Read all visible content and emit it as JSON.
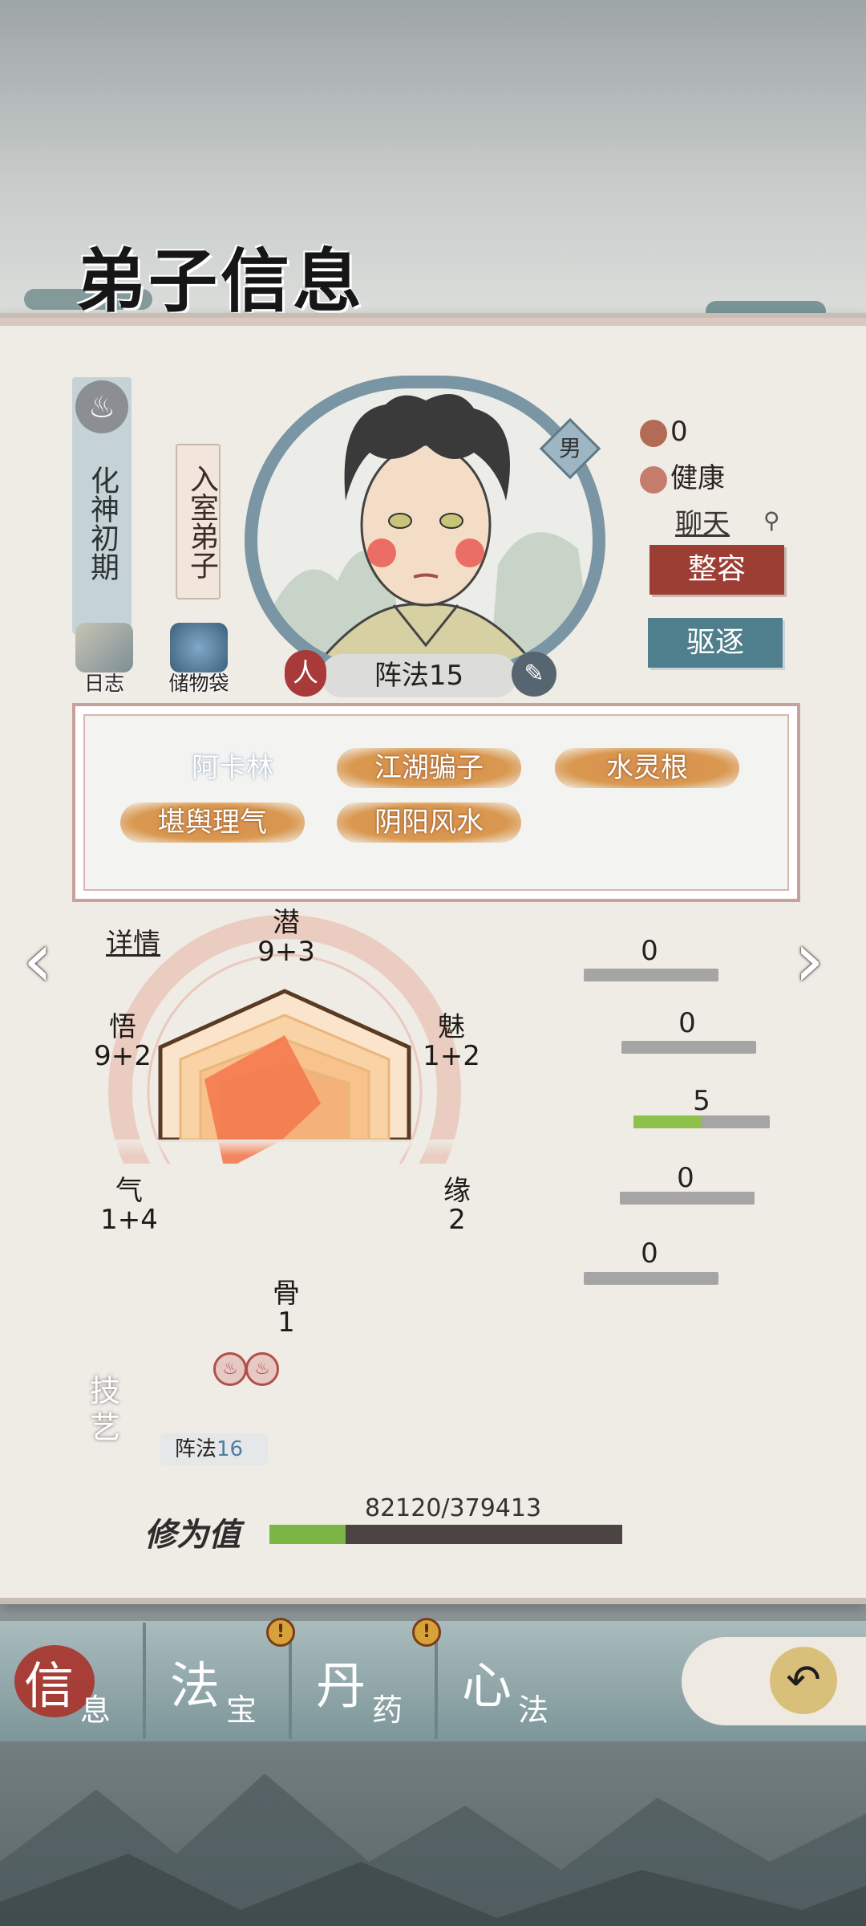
{
  "header": {
    "title": "弟子信息"
  },
  "profile": {
    "realm": "化神初期",
    "rank": "入室弟子",
    "gender": "男",
    "current_skill": "阵法15",
    "shortcuts": [
      {
        "label": "日志"
      },
      {
        "label": "储物袋"
      }
    ],
    "stats": {
      "mood_value": "0",
      "health": "健康"
    },
    "chat_link": "聊天",
    "buttons": {
      "face": "整容",
      "expel": "驱逐"
    }
  },
  "traits": {
    "name": "阿卡林",
    "items": [
      "江湖骗子",
      "水灵根",
      "堪舆理气",
      "阴阳风水"
    ]
  },
  "attributes": {
    "detail_link": "详情",
    "list": [
      {
        "name": "潜",
        "value": "9+3"
      },
      {
        "name": "悟",
        "value": "9+2"
      },
      {
        "name": "魅",
        "value": "1+2"
      },
      {
        "name": "气",
        "value": "1+4"
      },
      {
        "name": "缘",
        "value": "2"
      },
      {
        "name": "骨",
        "value": "1"
      }
    ]
  },
  "progress_bars": [
    {
      "value": "0",
      "fill": 0
    },
    {
      "value": "0",
      "fill": 0
    },
    {
      "value": "5",
      "fill": 0.5
    },
    {
      "value": "0",
      "fill": 0
    },
    {
      "value": "0",
      "fill": 0
    }
  ],
  "skills": {
    "title": "技艺",
    "name": "阵法",
    "level": "16"
  },
  "cultivation": {
    "label": "修为值",
    "text": "82120/379413",
    "fraction": 0.2164
  },
  "nav": {
    "tabs": [
      {
        "big": "信",
        "small": "息"
      },
      {
        "big": "法",
        "small": "宝"
      },
      {
        "big": "丹",
        "small": "药"
      },
      {
        "big": "心",
        "small": "法"
      }
    ]
  },
  "colors": {
    "accent_red": "#9d3e35",
    "accent_teal": "#4f7f8c",
    "trait_gold": "#d9984f",
    "radar_fill": "#f47a4f"
  }
}
